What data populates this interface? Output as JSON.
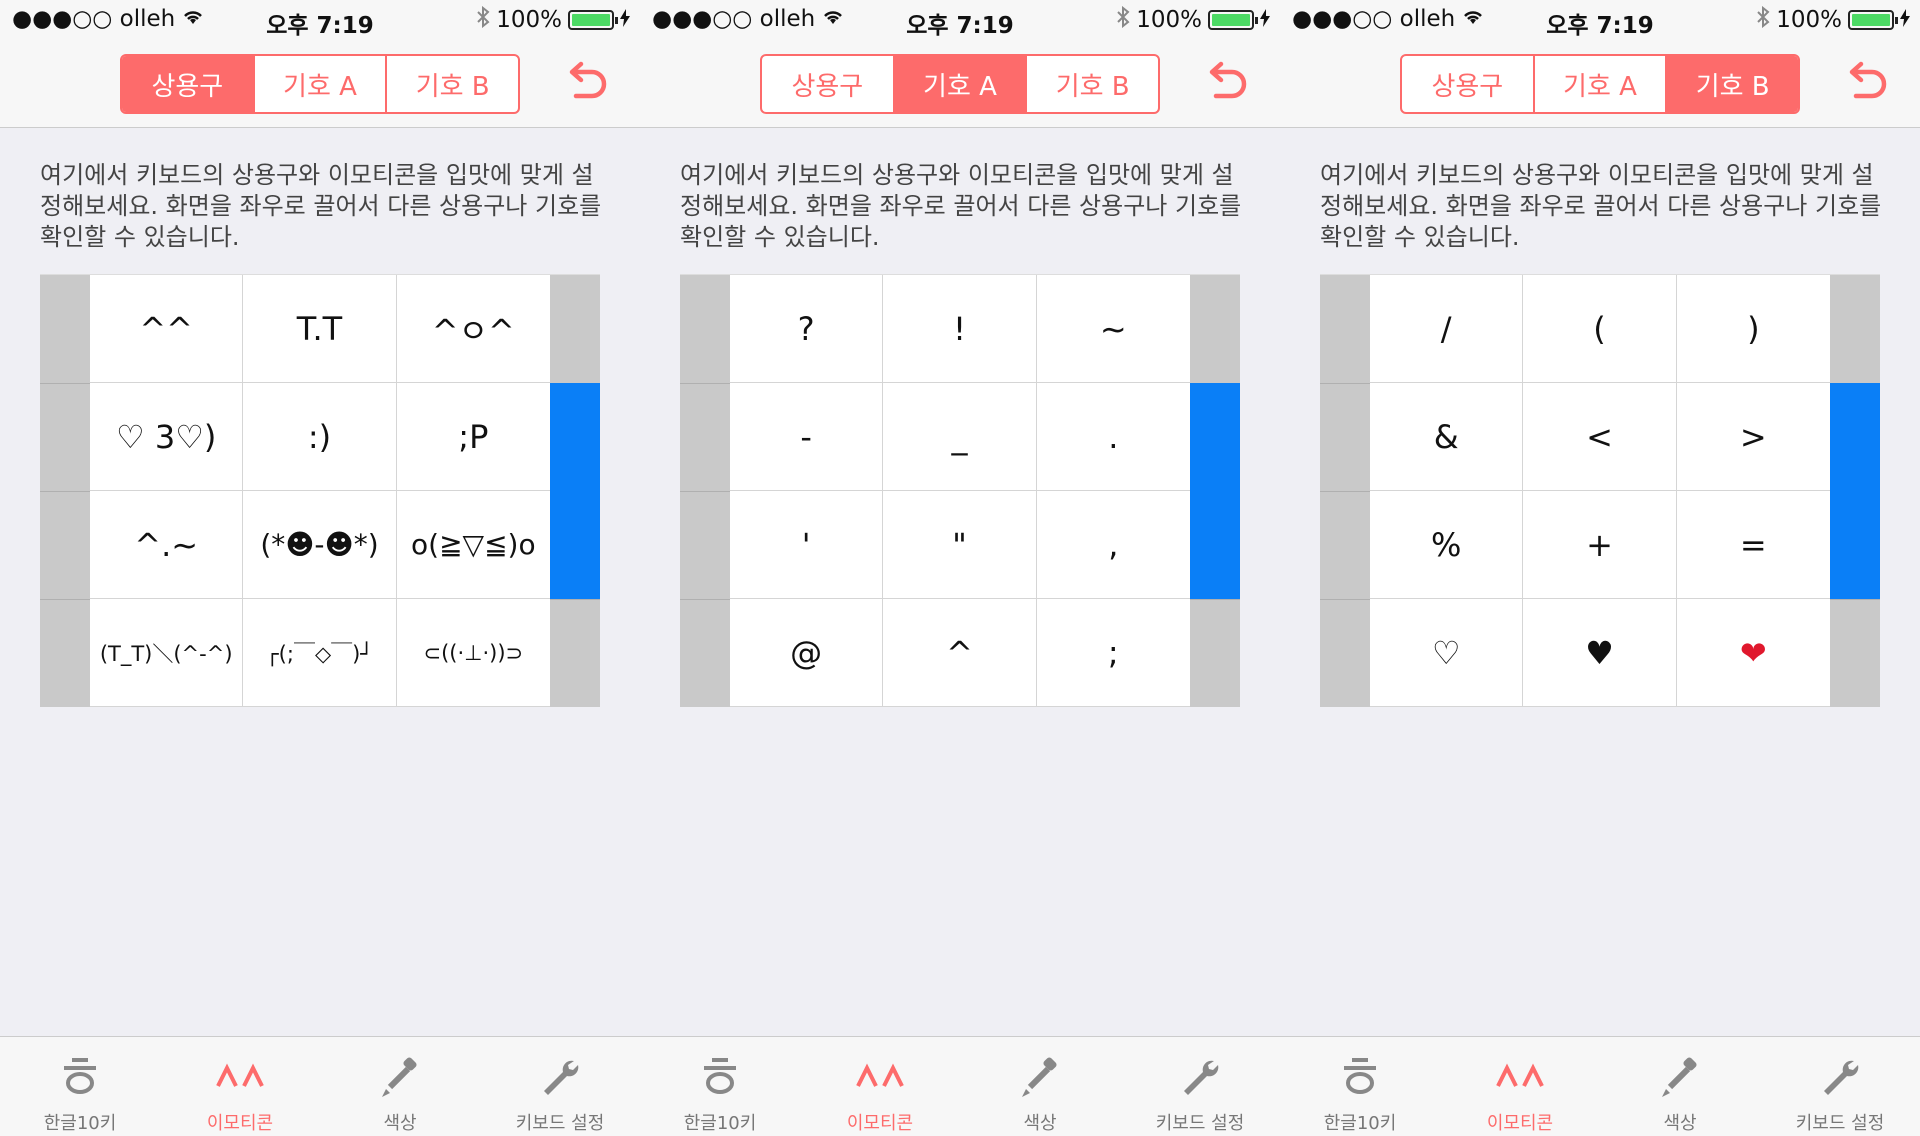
{
  "colors": {
    "accent": "#fd6b6b",
    "scroll_thumb": "#0a7ff7",
    "battery": "#4cd964"
  },
  "screens": [
    {
      "status": {
        "carrier": "●●●○○ olleh",
        "time": "오후 7:19",
        "battery": "100%"
      },
      "segments": [
        "상용구",
        "기호 A",
        "기호 B"
      ],
      "active_segment": 0,
      "description": "여기에서 키보드의 상용구와 이모티콘을 입맛에 맞게 설정해보세요. 화면을 좌우로 끌어서 다른 상용구나 기호를 확인할 수 있습니다.",
      "cells": [
        "^^",
        "T.T",
        "^ㅇ^",
        "♡ 3♡)",
        ":)",
        ";P",
        "^.~",
        "(*☻-☻*)",
        "o(≧▽≦)o",
        "(T_T)＼(^-^)",
        "┌(;￣◇￣)┘",
        "⊂((·⊥·))⊃"
      ],
      "tabs": [
        {
          "label": "한글10키",
          "icon": "hieut-icon"
        },
        {
          "label": "이모티콘",
          "icon": "caret-emoticon-icon"
        },
        {
          "label": "색상",
          "icon": "eyedropper-icon"
        },
        {
          "label": "키보드 설정",
          "icon": "wrench-icon"
        }
      ],
      "active_tab": 1
    },
    {
      "status": {
        "carrier": "●●●○○ olleh",
        "time": "오후 7:19",
        "battery": "100%"
      },
      "segments": [
        "상용구",
        "기호 A",
        "기호 B"
      ],
      "active_segment": 1,
      "description": "여기에서 키보드의 상용구와 이모티콘을 입맛에 맞게 설정해보세요. 화면을 좌우로 끌어서 다른 상용구나 기호를 확인할 수 있습니다.",
      "cells": [
        "?",
        "!",
        "~",
        "-",
        "_",
        ".",
        "'",
        "\"",
        ",",
        "@",
        "^",
        ";"
      ],
      "tabs": [
        {
          "label": "한글10키",
          "icon": "hieut-icon"
        },
        {
          "label": "이모티콘",
          "icon": "caret-emoticon-icon"
        },
        {
          "label": "색상",
          "icon": "eyedropper-icon"
        },
        {
          "label": "키보드 설정",
          "icon": "wrench-icon"
        }
      ],
      "active_tab": 1
    },
    {
      "status": {
        "carrier": "●●●○○ olleh",
        "time": "오후 7:19",
        "battery": "100%"
      },
      "segments": [
        "상용구",
        "기호 A",
        "기호 B"
      ],
      "active_segment": 2,
      "description": "여기에서 키보드의 상용구와 이모티콘을 입맛에 맞게 설정해보세요. 화면을 좌우로 끌어서 다른 상용구나 기호를 확인할 수 있습니다.",
      "cells": [
        "/",
        "(",
        ")",
        "&",
        "<",
        ">",
        "%",
        "+",
        "=",
        "♡",
        "♥",
        "❤"
      ],
      "tabs": [
        {
          "label": "한글10키",
          "icon": "hieut-icon"
        },
        {
          "label": "이모티콘",
          "icon": "caret-emoticon-icon"
        },
        {
          "label": "색상",
          "icon": "eyedropper-icon"
        },
        {
          "label": "키보드 설정",
          "icon": "wrench-icon"
        }
      ],
      "active_tab": 1
    }
  ]
}
